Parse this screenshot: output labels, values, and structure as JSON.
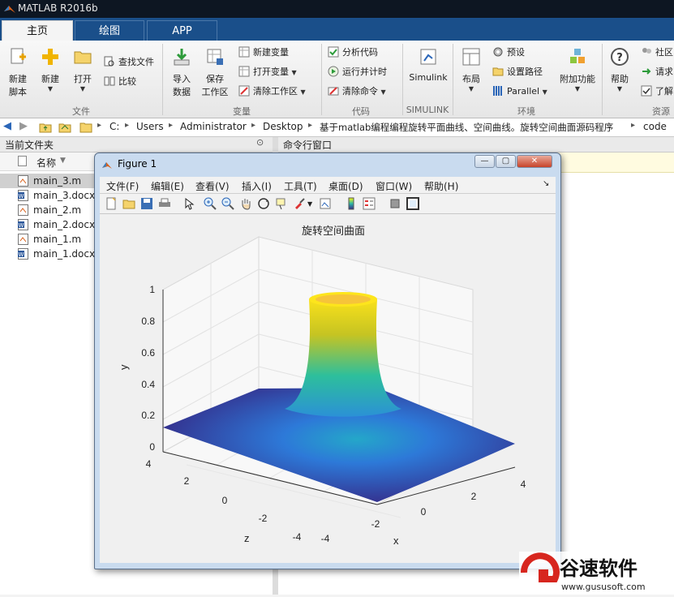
{
  "app": {
    "title": "MATLAB R2016b"
  },
  "tabs": [
    {
      "label": "主页",
      "active": true
    },
    {
      "label": "绘图",
      "active": false
    },
    {
      "label": "APP",
      "active": false
    }
  ],
  "ribbon": {
    "file_group": {
      "label": "文件",
      "new_script": [
        "新建",
        "脚本"
      ],
      "new": "新建",
      "open": "打开",
      "find_files": "查找文件",
      "compare": "比较"
    },
    "var_group": {
      "label": "变量",
      "import_data": [
        "导入",
        "数据"
      ],
      "save_workspace": [
        "保存",
        "工作区"
      ],
      "new_variable": "新建变量",
      "open_variable": "打开变量",
      "clear_workspace": "清除工作区"
    },
    "code_group": {
      "label": "代码",
      "analyze_code": "分析代码",
      "run_and_time": "运行并计时",
      "clear_commands": "清除命令"
    },
    "simulink_group": {
      "label": "SIMULINK",
      "simulink": "Simulink"
    },
    "env_group": {
      "label": "环境",
      "layout": "布局",
      "preferences": "预设",
      "set_path": "设置路径",
      "parallel": "Parallel",
      "addons": "附加功能"
    },
    "resources_group": {
      "label": "资源",
      "help": "帮助",
      "community": "社区",
      "request": "请求",
      "learn": "了解"
    }
  },
  "address": {
    "path": [
      "C:",
      "Users",
      "Administrator",
      "Desktop",
      "基于matlab编程编程旋转平面曲线、空间曲线。旋转空间曲面源码程序",
      "code"
    ]
  },
  "current_folder": {
    "title": "当前文件夹",
    "column_name": "名称",
    "files": [
      {
        "name": "main_3.m",
        "type": "m",
        "selected": true
      },
      {
        "name": "main_3.docx",
        "type": "docx",
        "selected": false
      },
      {
        "name": "main_2.m",
        "type": "m",
        "selected": false
      },
      {
        "name": "main_2.docx",
        "type": "docx",
        "selected": false
      },
      {
        "name": "main_1.m",
        "type": "m",
        "selected": false
      },
      {
        "name": "main_1.docx",
        "type": "docx",
        "selected": false
      }
    ]
  },
  "command_window": {
    "title": "命令行窗口"
  },
  "figure": {
    "title": "Figure 1",
    "menu": [
      "文件(F)",
      "编辑(E)",
      "查看(V)",
      "插入(I)",
      "工具(T)",
      "桌面(D)",
      "窗口(W)",
      "帮助(H)"
    ],
    "plot_title": "旋转空间曲面",
    "xlabel": "x",
    "ylabel": "y",
    "zlabel": "z",
    "y_ticks": [
      "1",
      "0.8",
      "0.6",
      "0.4",
      "0.2",
      "0"
    ],
    "z_ticks": [
      "4",
      "2",
      "0",
      "-2",
      "-4"
    ],
    "x_ticks": [
      "-4",
      "-2",
      "0",
      "2",
      "4"
    ]
  },
  "chart_data": {
    "type": "surface",
    "title": "旋转空间曲面",
    "xlabel": "x",
    "ylabel": "y",
    "zlabel": "z",
    "xlim": [
      -4,
      4
    ],
    "zlim": [
      -4,
      4
    ],
    "ylim": [
      0,
      1
    ],
    "grid": true,
    "colormap": "parula"
  },
  "watermark": {
    "brand": "谷速软件",
    "url": "www.gususoft.com"
  }
}
